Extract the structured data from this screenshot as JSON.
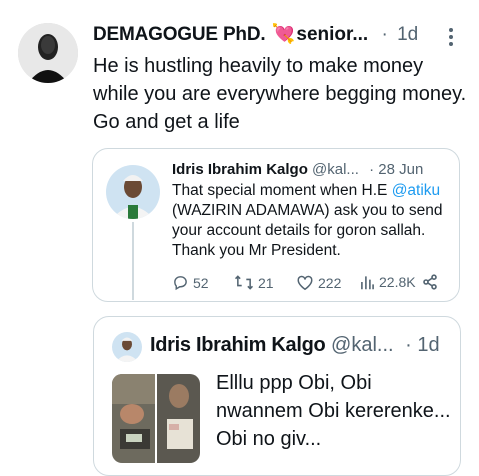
{
  "main_tweet": {
    "author_name": "DEMAGOGUE PhD.",
    "author_suffix": "senior...",
    "heart_emoji": "💘",
    "dot": "·",
    "time": "1d",
    "text": "He is hustling heavily to make money while you are everywhere begging money.  Go and get a life"
  },
  "quoted_tweet": {
    "author_name": "Idris Ibrahim Kalgo",
    "handle": "@kal...",
    "dot": "·",
    "time": "28 Jun",
    "text_before": "That special moment when H.E ",
    "mention": "@atiku",
    "text_after": " (WAZIRIN ADAMAWA) ask you to send your account details for goron sallah. Thank you Mr President.",
    "stats": {
      "replies": "52",
      "retweets": "21",
      "likes": "222",
      "views": "22.8K"
    }
  },
  "quoted_tweet_2": {
    "author_name": "Idris Ibrahim Kalgo",
    "handle": "@kal...",
    "dot": "·",
    "time": "1d",
    "text": "Elllu ppp Obi, Obi nwannem Obi kererenke... Obi no giv..."
  },
  "icons": {
    "more": "more-vertical-icon",
    "reply": "reply-icon",
    "retweet": "retweet-icon",
    "like": "heart-icon",
    "views": "views-chart-icon",
    "share": "share-icon"
  },
  "colors": {
    "link": "#1d9bf0",
    "muted": "#536471",
    "border": "#cfd9de"
  }
}
